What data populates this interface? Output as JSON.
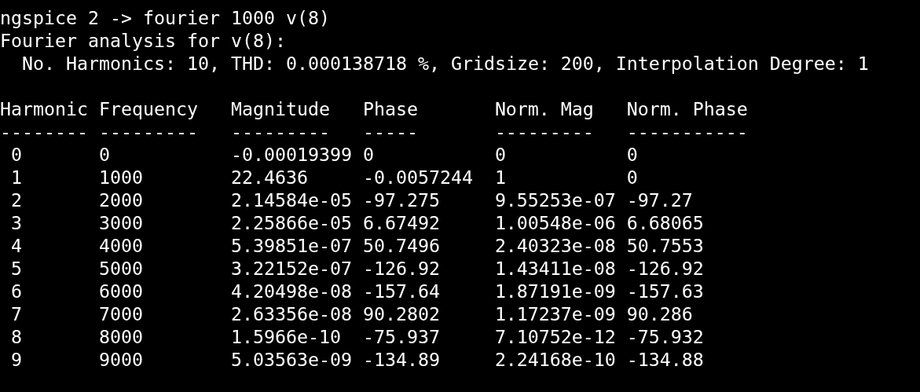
{
  "terminal": {
    "command_line": "ngspice 2 -> fourier 1000 v(8)",
    "heading": "Fourier analysis for v(8):",
    "summary": "No. Harmonics: 10, THD: 0.000138718 %, Gridsize: 200, Interpolation Degree: 1",
    "table": {
      "columns": [
        "Harmonic",
        "Frequency",
        "Magnitude",
        "Phase",
        "Norm. Mag",
        "Norm. Phase"
      ],
      "separators": [
        "--------",
        "---------",
        "---------",
        "-----",
        "---------",
        "-----------"
      ],
      "rows": [
        [
          "0",
          "0",
          "-0.00019399",
          "0",
          "0",
          "0"
        ],
        [
          "1",
          "1000",
          "22.4636",
          "-0.0057244",
          "1",
          "0"
        ],
        [
          "2",
          "2000",
          "2.14584e-05",
          "-97.275",
          "9.55253e-07",
          "-97.27"
        ],
        [
          "3",
          "3000",
          "2.25866e-05",
          "6.67492",
          "1.00548e-06",
          "6.68065"
        ],
        [
          "4",
          "4000",
          "5.39851e-07",
          "50.7496",
          "2.40323e-08",
          "50.7553"
        ],
        [
          "5",
          "5000",
          "3.22152e-07",
          "-126.92",
          "1.43411e-08",
          "-126.92"
        ],
        [
          "6",
          "6000",
          "4.20498e-08",
          "-157.64",
          "1.87191e-09",
          "-157.63"
        ],
        [
          "7",
          "7000",
          "2.63356e-08",
          "90.2802",
          "1.17237e-09",
          "90.286"
        ],
        [
          "8",
          "8000",
          "1.5966e-10",
          "-75.937",
          "7.10752e-12",
          "-75.932"
        ],
        [
          "9",
          "9000",
          "5.03563e-09",
          "-134.89",
          "2.24168e-10",
          "-134.88"
        ]
      ]
    }
  }
}
